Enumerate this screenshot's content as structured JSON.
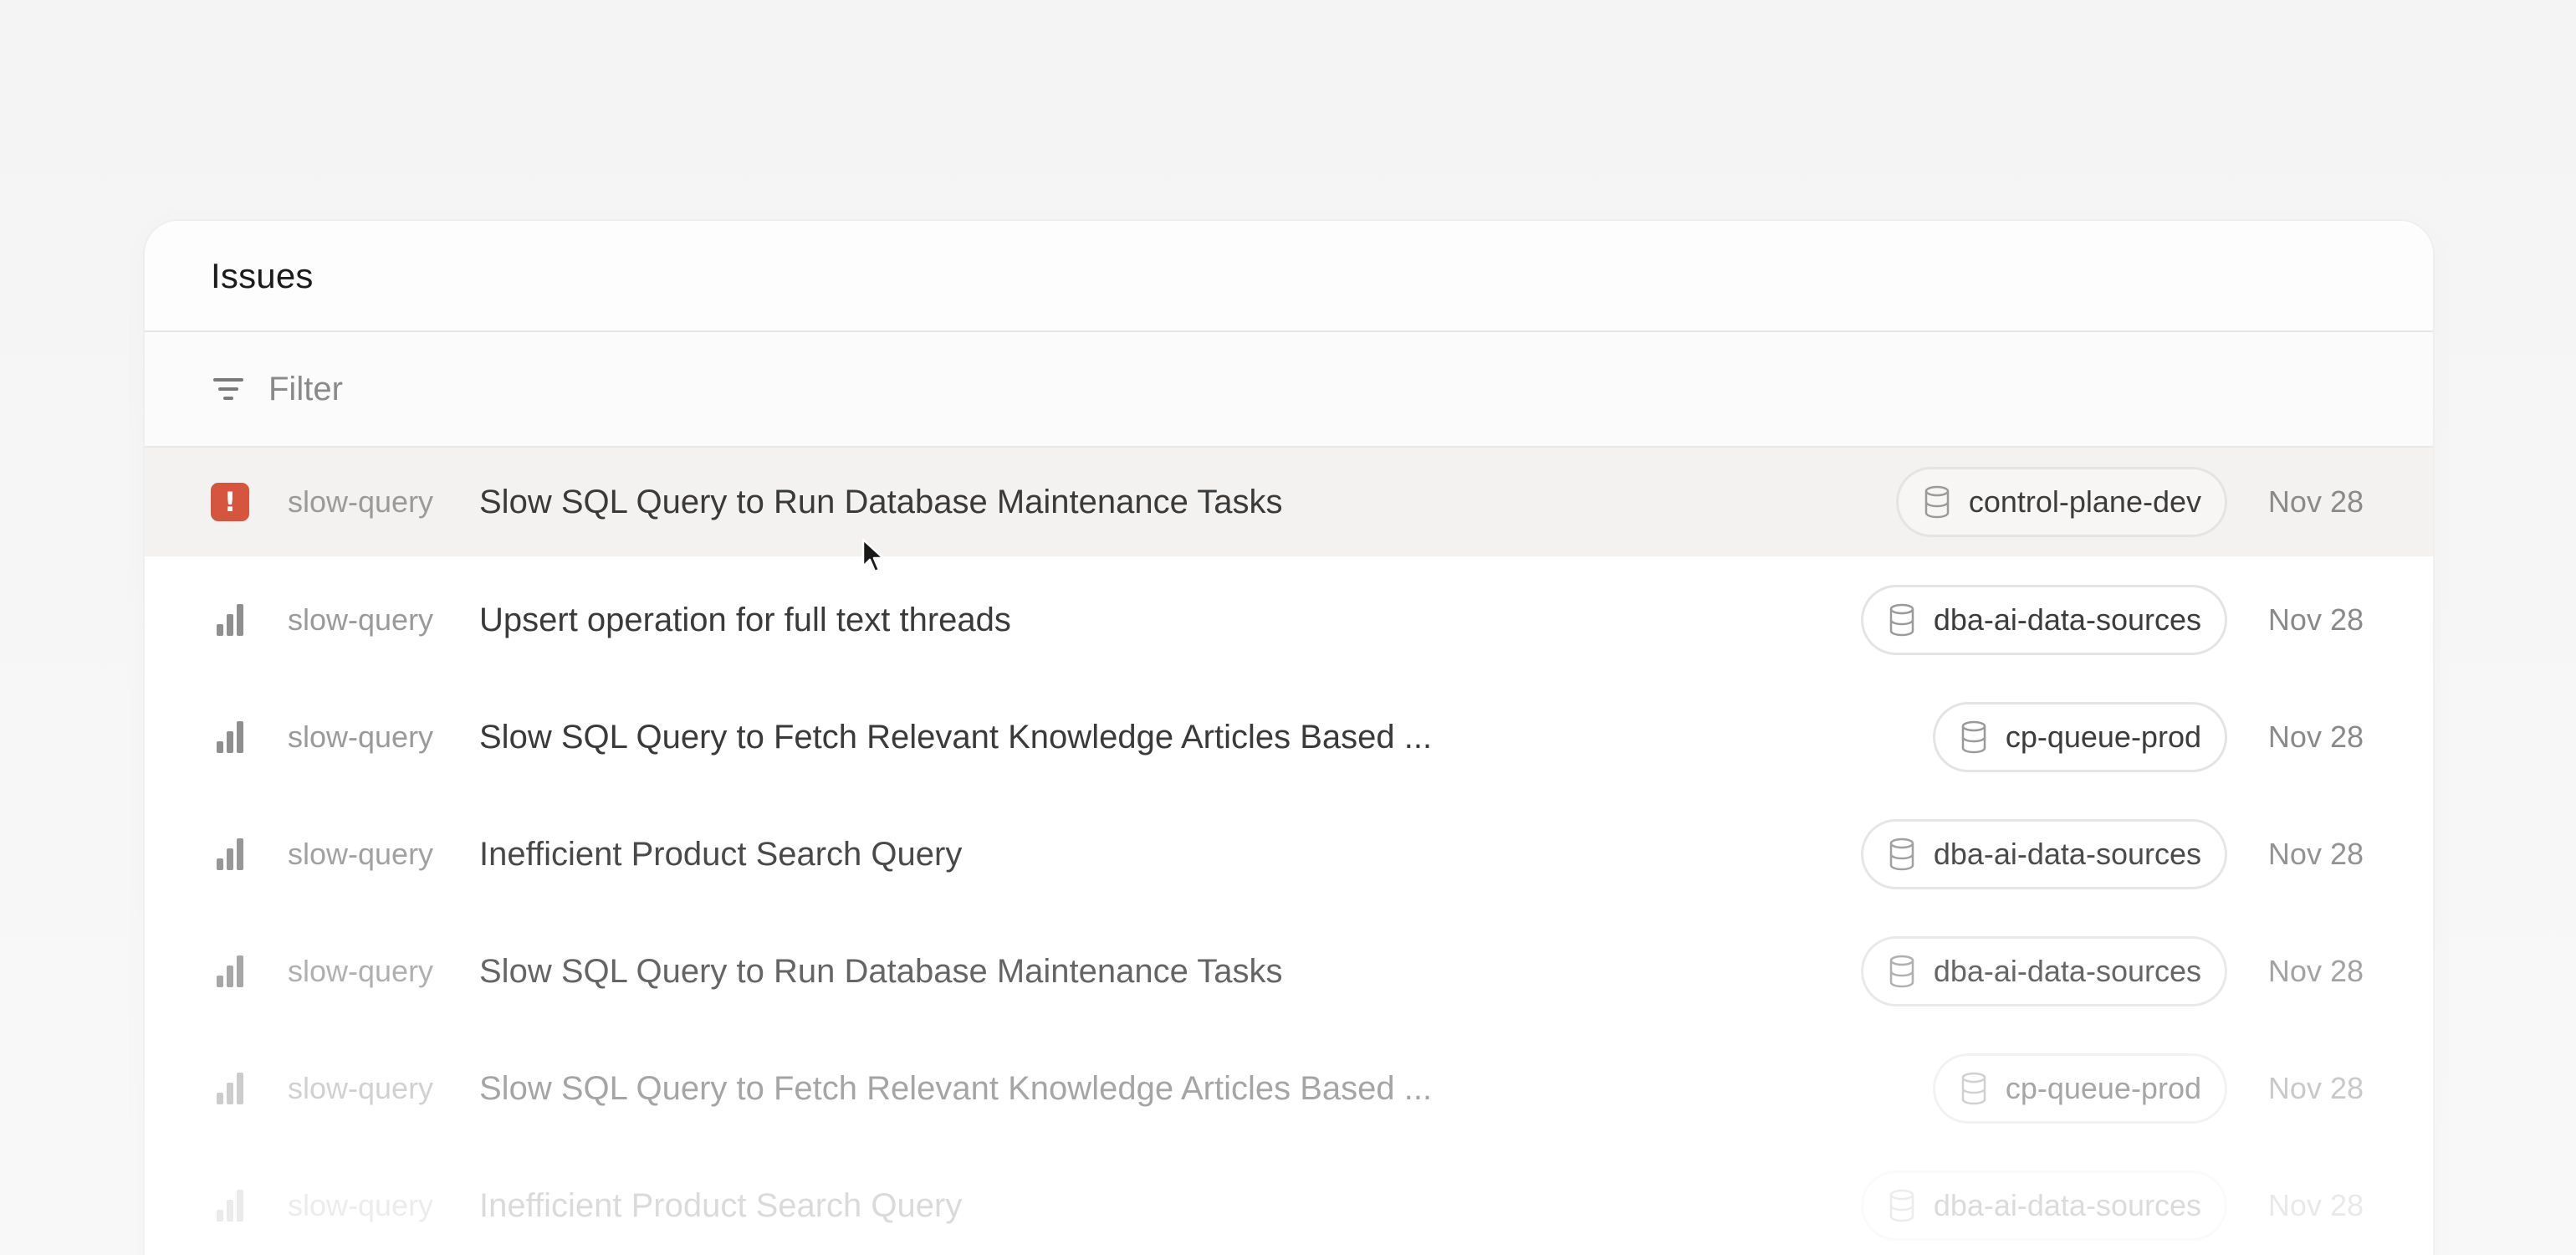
{
  "panel": {
    "title": "Issues"
  },
  "filter": {
    "label": "Filter",
    "icon": "filter-icon"
  },
  "colors": {
    "urgent": "#d5553f",
    "hover_row": "#f3f2f1"
  },
  "issues": [
    {
      "priority": "urgent",
      "type": "slow-query",
      "title": "Slow SQL Query to Run Database Maintenance Tasks",
      "database": "control-plane-dev",
      "date": "Nov 28"
    },
    {
      "priority": "bars",
      "type": "slow-query",
      "title": "Upsert operation for full text threads",
      "database": "dba-ai-data-sources",
      "date": "Nov 28"
    },
    {
      "priority": "bars",
      "type": "slow-query",
      "title": "Slow SQL Query to Fetch Relevant Knowledge Articles Based ...",
      "database": "cp-queue-prod",
      "date": "Nov 28"
    },
    {
      "priority": "bars",
      "type": "slow-query",
      "title": "Inefficient Product Search Query",
      "database": "dba-ai-data-sources",
      "date": "Nov 28"
    },
    {
      "priority": "bars",
      "type": "slow-query",
      "title": "Slow SQL Query to Run Database Maintenance Tasks",
      "database": "dba-ai-data-sources",
      "date": "Nov 28"
    },
    {
      "priority": "bars",
      "type": "slow-query",
      "title": "Slow SQL Query to Fetch Relevant Knowledge Articles Based ...",
      "database": "cp-queue-prod",
      "date": "Nov 28"
    },
    {
      "priority": "bars",
      "type": "slow-query",
      "title": "Inefficient Product Search Query",
      "database": "dba-ai-data-sources",
      "date": "Nov 28"
    }
  ]
}
